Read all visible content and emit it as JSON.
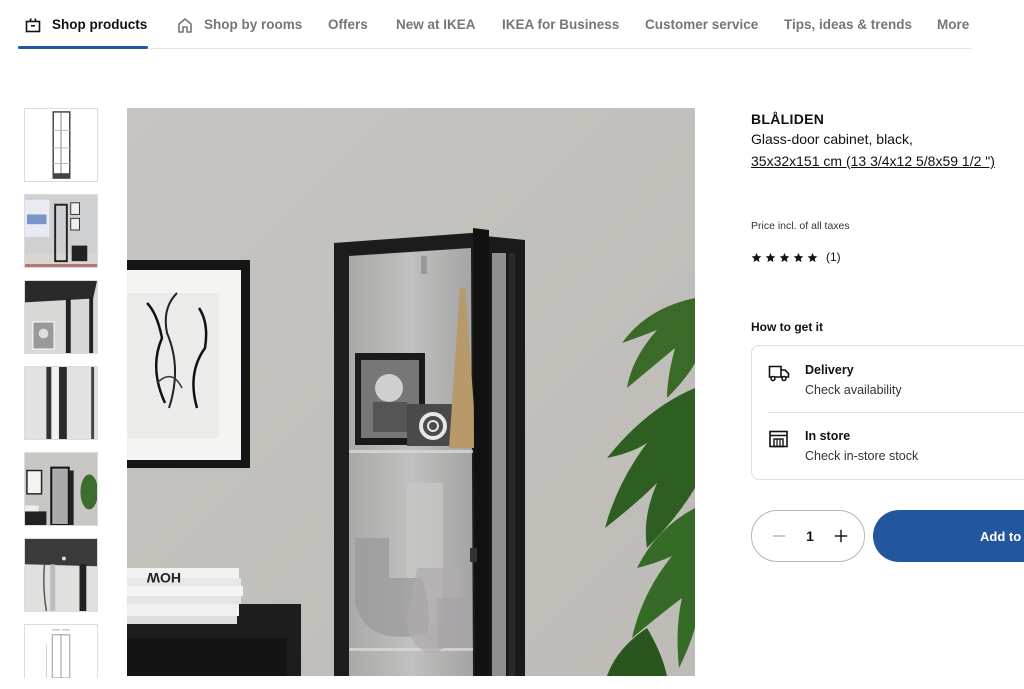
{
  "nav": {
    "items": [
      {
        "label": "Shop products",
        "icon": "shop-bag-icon",
        "active": true
      },
      {
        "label": "Shop by rooms",
        "icon": "home-icon",
        "active": false
      },
      {
        "label": "Offers",
        "active": false
      },
      {
        "label": "New at IKEA",
        "active": false
      },
      {
        "label": "IKEA for Business",
        "active": false
      },
      {
        "label": "Customer service",
        "active": false
      },
      {
        "label": "Tips, ideas & trends",
        "active": false
      },
      {
        "label": "More",
        "active": false
      }
    ],
    "accent_color": "#1f57a8"
  },
  "gallery": {
    "thumbnails": [
      {
        "alt": "Cabinet product shot"
      },
      {
        "alt": "Cabinet in living room"
      },
      {
        "alt": "Cabinet top corner detail"
      },
      {
        "alt": "Cabinet door edge detail"
      },
      {
        "alt": "Cabinet styled with plant"
      },
      {
        "alt": "Cabinet top with lighting cable"
      },
      {
        "alt": "Cabinet dimensions drawing"
      }
    ],
    "main_image_alt": "BLÅLIDEN glass-door cabinet with decor next to a plant"
  },
  "product": {
    "name": "BLÅLIDEN",
    "description": "Glass-door cabinet, black,",
    "dimensions": "35x32x151 cm (13 3/4x12 5/8x59 1/2 \")",
    "price_note": "Price incl. of all taxes",
    "rating": {
      "stars": 5,
      "max": 5,
      "count_label": "(1)"
    }
  },
  "how_to_get": {
    "title": "How to get it",
    "options": [
      {
        "title": "Delivery",
        "subtitle": "Check availability",
        "icon": "truck-icon"
      },
      {
        "title": "In store",
        "subtitle": "Check in-store stock",
        "icon": "store-icon"
      }
    ]
  },
  "purchase": {
    "quantity": "1",
    "add_label": "Add to",
    "button_color": "#2456a0"
  }
}
